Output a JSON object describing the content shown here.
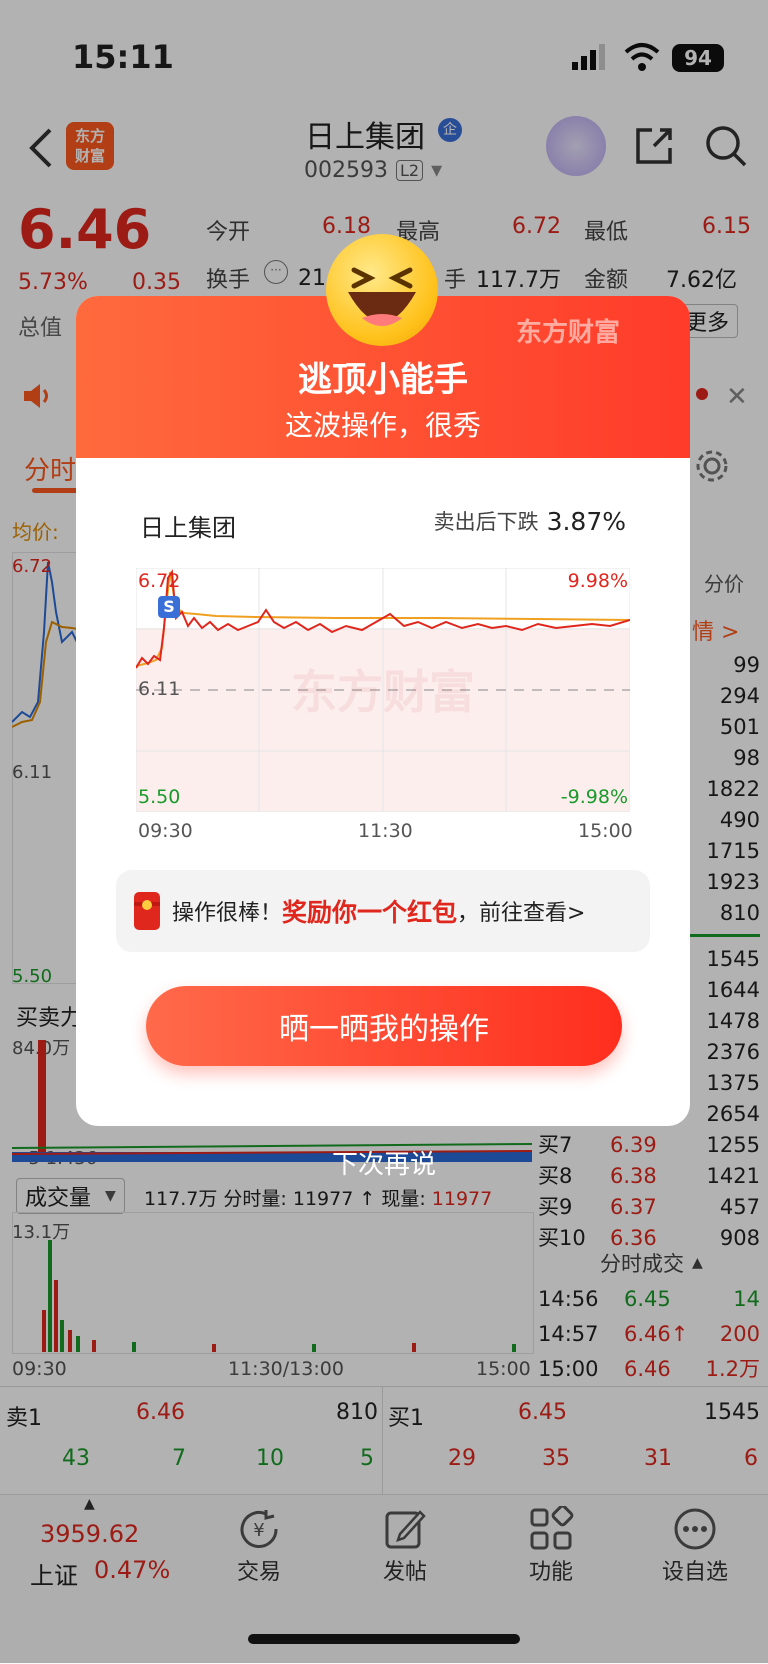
{
  "status_bar": {
    "time": "15:11",
    "battery": "94"
  },
  "header": {
    "brand_badge_line1": "东方",
    "brand_badge_line2": "财富",
    "stock_name": "日上集团",
    "stock_code": "002593",
    "level": "L2"
  },
  "quote": {
    "price": "6.46",
    "pct": "5.73%",
    "change": "0.35",
    "open_label": "今开",
    "open": "6.18",
    "high_label": "最高",
    "high": "6.72",
    "low_label": "最低",
    "low": "6.15",
    "turnover_label": "换手",
    "turnover": "21.",
    "volume_label": "手",
    "volume": "117.7万",
    "amount_label": "金额",
    "amount": "7.62亿",
    "mcap_label": "总值",
    "more_label": "更多"
  },
  "tabs": {
    "minute": "分时",
    "avg": "均价:",
    "fen_jia": "分价",
    "detail": "情 >"
  },
  "main_chart": {
    "price_top": "6.72",
    "price_mid": "6.11",
    "price_bottom": "5.50",
    "buy_sell_label": "买卖力",
    "bs_max": "84.0万",
    "bs_low": "-5 1.436"
  },
  "volume_panel": {
    "selector": "成交量",
    "info_text": "117.7万 分时量: 11977 ↑ 现量: ",
    "now_volume": "11977",
    "max_vol": "13.1万",
    "x_start": "09:30",
    "x_mid": "11:30/13:00",
    "x_end": "15:00"
  },
  "order_book": {
    "sell_volumes": [
      "99",
      "294",
      "501",
      "98",
      "1822",
      "490",
      "1715",
      "1923",
      "810"
    ],
    "buy_volumes": [
      "1545",
      "1644",
      "1478",
      "2376",
      "1375",
      "2654"
    ],
    "buy_rows": [
      {
        "label": "买7",
        "price": "6.39",
        "vol": "1255"
      },
      {
        "label": "买8",
        "price": "6.38",
        "vol": "1421"
      },
      {
        "label": "买9",
        "price": "6.37",
        "vol": "457"
      },
      {
        "label": "买10",
        "price": "6.36",
        "vol": "908"
      }
    ]
  },
  "ticks": {
    "title": "分时成交",
    "rows": [
      {
        "time": "14:56",
        "price": "6.45",
        "vol": "14"
      },
      {
        "time": "14:57",
        "price": "6.46↑",
        "vol": "200"
      },
      {
        "time": "15:00",
        "price": "6.46",
        "vol": "1.2万"
      }
    ]
  },
  "level1": {
    "sell1_label": "卖1",
    "sell1_price": "6.46",
    "sell1_vol": "810",
    "buy1_label": "买1",
    "buy1_price": "6.45",
    "buy1_vol": "1545",
    "sell_orders": [
      "43",
      "7",
      "10",
      "5"
    ],
    "buy_orders": [
      "29",
      "35",
      "31",
      "6"
    ]
  },
  "bottom_bar": {
    "index_value": "3959.62",
    "index_name": "上证",
    "index_pct": "0.47%",
    "trade": "交易",
    "post": "发帖",
    "function": "功能",
    "watch": "设自选"
  },
  "modal": {
    "brand": "东方财富",
    "title": "逃顶小能手",
    "subtitle": "这波操作，很秀",
    "stock": "日上集团",
    "drop_label": "卖出后下跌",
    "drop_value": "3.87%",
    "chart_top_left": "6.72",
    "chart_top_right": "9.98%",
    "chart_mid": "6.11",
    "chart_bottom_left": "5.50",
    "chart_bottom_right": "-9.98%",
    "watermark": "东方财富",
    "x_start": "09:30",
    "x_mid": "11:30",
    "x_end": "15:00",
    "reward_prefix": "操作很棒！",
    "reward_highlight": "奖励你一个红包",
    "reward_suffix": "，前往查看>",
    "share_button": "晒一晒我的操作",
    "later": "下次再说"
  },
  "colors": {
    "accent_red": "#e0271d",
    "green": "#1a9a2a",
    "brand_orange": "#ff4a2e"
  }
}
